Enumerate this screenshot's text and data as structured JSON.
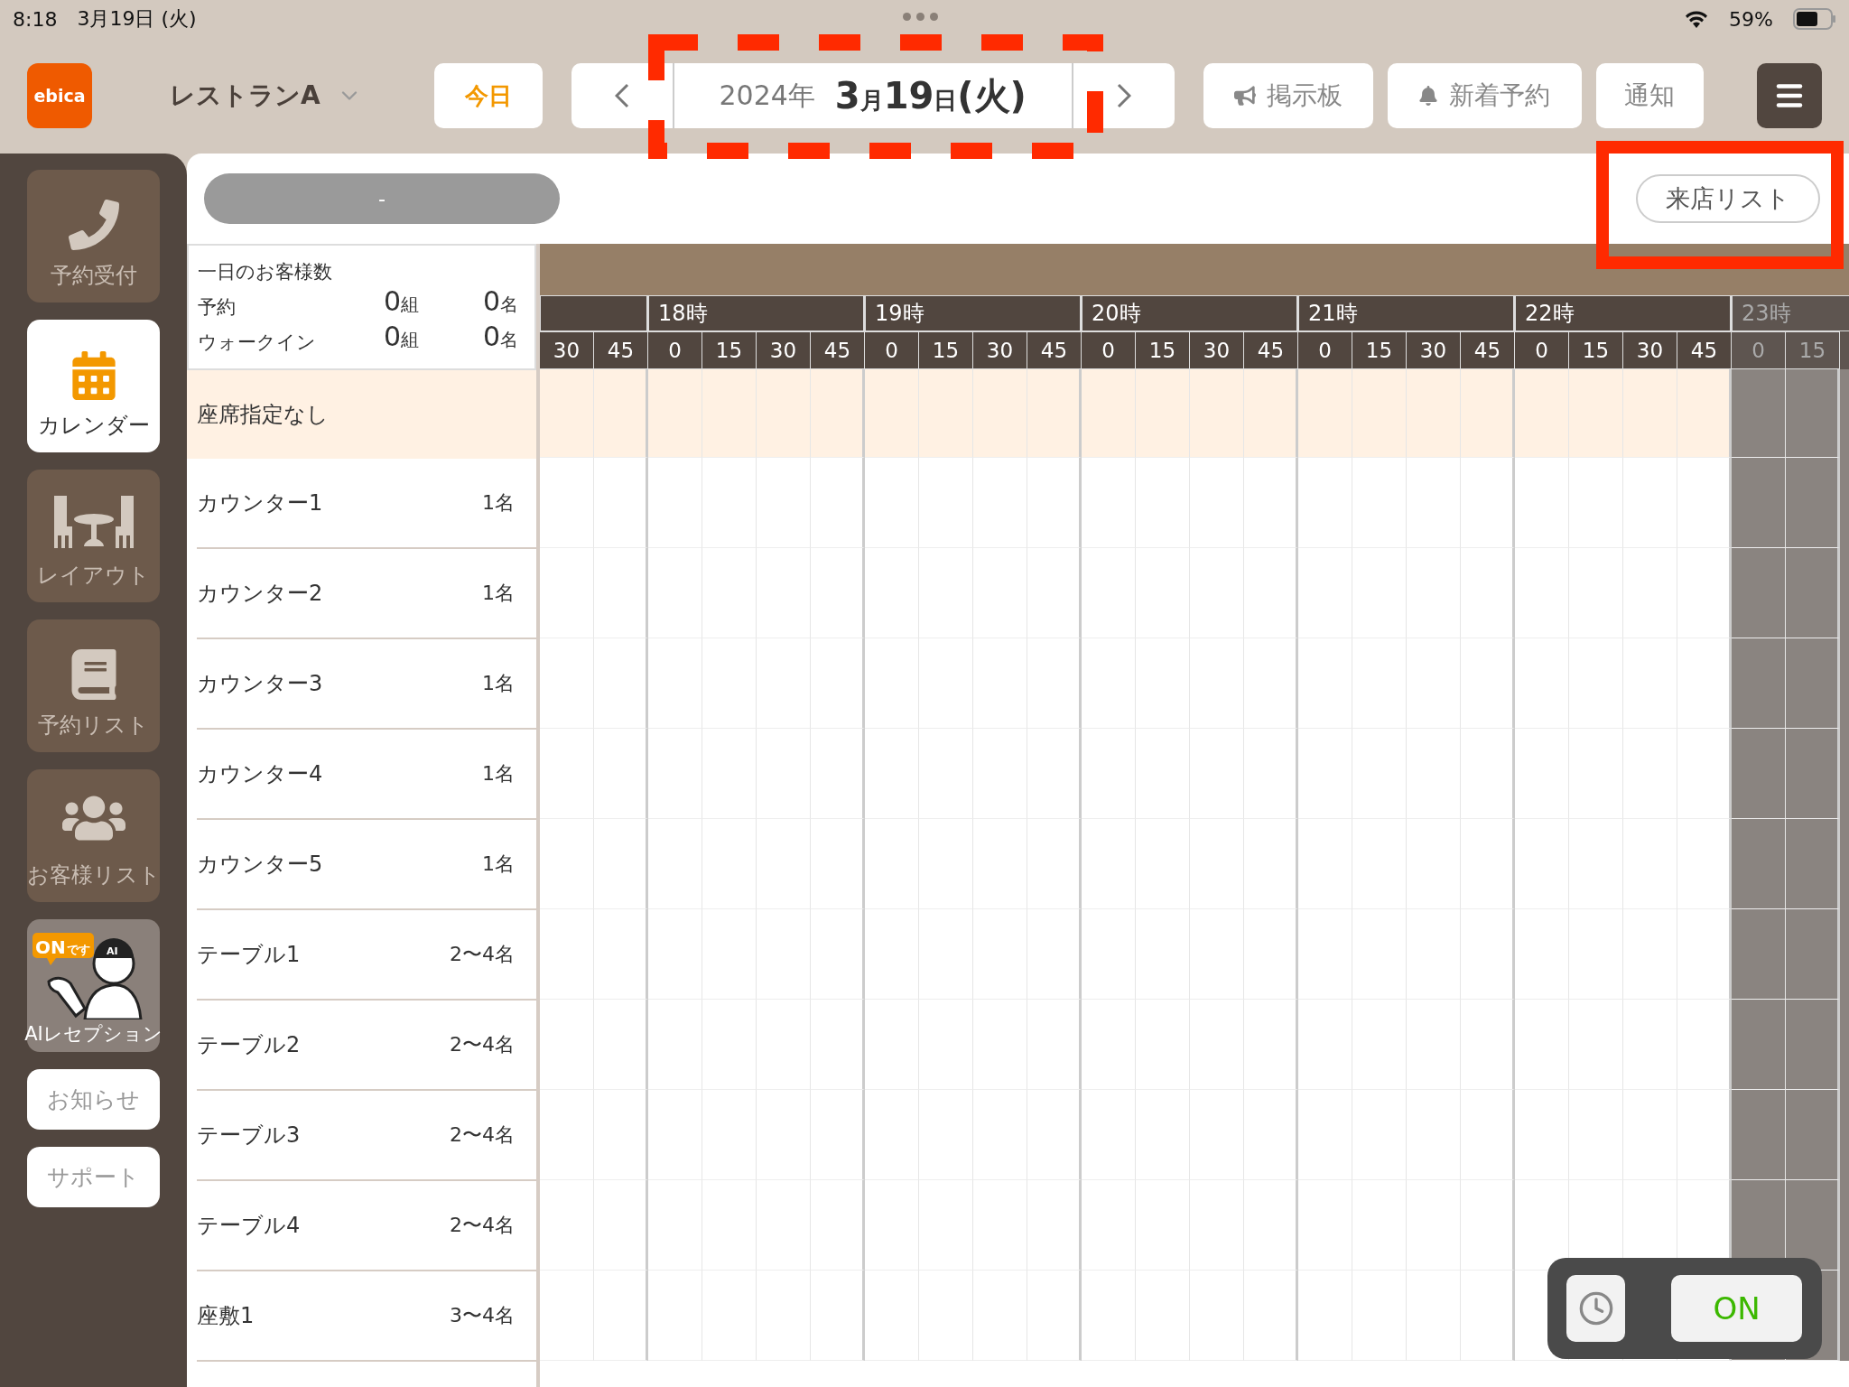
{
  "status_bar": {
    "time": "8:18",
    "date": "3月19日 (火)",
    "battery": "59%"
  },
  "header": {
    "logo": "ebica",
    "store": "レストランA",
    "today": "今日",
    "date": {
      "year": "2024年",
      "month": "3",
      "month_unit": "月",
      "day": "19",
      "day_unit": "日",
      "weekday": "(火)"
    },
    "buttons": [
      {
        "label": "掲示板",
        "kind": "megaphone"
      },
      {
        "label": "新着予約",
        "kind": "bell"
      },
      {
        "label": "通知",
        "kind": "plain"
      }
    ]
  },
  "sidebar": {
    "items": [
      {
        "label": "予約受付",
        "kind": "phone",
        "selected": false
      },
      {
        "label": "カレンダー",
        "kind": "calendar",
        "selected": true
      },
      {
        "label": "レイアウト",
        "kind": "layout",
        "selected": false
      },
      {
        "label": "予約リスト",
        "kind": "book",
        "selected": false
      },
      {
        "label": "お客様リスト",
        "kind": "users",
        "selected": false
      },
      {
        "label": "AIレセプション",
        "kind": "ai",
        "selected": false,
        "badge": "ON",
        "badge_suffix": "です",
        "cap_text": "AI"
      },
      {
        "label": "お知らせ",
        "kind": "plain",
        "selected": false
      },
      {
        "label": "サポート",
        "kind": "plain",
        "selected": false
      }
    ]
  },
  "toolbar": {
    "filter": "-",
    "visit_list": "来店リスト"
  },
  "summary": {
    "title": "一日のお客様数",
    "rows": [
      {
        "label": "予約",
        "groups": "0",
        "groups_unit": "組",
        "people": "0",
        "people_unit": "名"
      },
      {
        "label": "ウォークイン",
        "groups": "0",
        "groups_unit": "組",
        "people": "0",
        "people_unit": "名"
      }
    ]
  },
  "timeline": {
    "hours": [
      {
        "minutes": [
          "30",
          "45"
        ],
        "closed": false
      },
      {
        "label": "18時",
        "minutes": [
          "0",
          "15",
          "30",
          "45"
        ],
        "closed": false
      },
      {
        "label": "19時",
        "minutes": [
          "0",
          "15",
          "30",
          "45"
        ],
        "closed": false
      },
      {
        "label": "20時",
        "minutes": [
          "0",
          "15",
          "30",
          "45"
        ],
        "closed": false
      },
      {
        "label": "21時",
        "minutes": [
          "0",
          "15",
          "30",
          "45"
        ],
        "closed": false
      },
      {
        "label": "22時",
        "minutes": [
          "0",
          "15",
          "30",
          "45"
        ],
        "closed": false
      },
      {
        "label": "23時",
        "minutes": [
          "0",
          "15"
        ],
        "closed": true
      }
    ]
  },
  "seats": [
    {
      "name": "座席指定なし",
      "kind": "unassigned"
    },
    {
      "name": "カウンター1",
      "capacity": "1名",
      "kind": "seat"
    },
    {
      "name": "カウンター2",
      "capacity": "1名",
      "kind": "seat"
    },
    {
      "name": "カウンター3",
      "capacity": "1名",
      "kind": "seat"
    },
    {
      "name": "カウンター4",
      "capacity": "1名",
      "kind": "seat"
    },
    {
      "name": "カウンター5",
      "capacity": "1名",
      "kind": "seat"
    },
    {
      "name": "テーブル1",
      "capacity": "2〜4名",
      "kind": "seat"
    },
    {
      "name": "テーブル2",
      "capacity": "2〜4名",
      "kind": "seat"
    },
    {
      "name": "テーブル3",
      "capacity": "2〜4名",
      "kind": "seat"
    },
    {
      "name": "テーブル4",
      "capacity": "2〜4名",
      "kind": "seat"
    },
    {
      "name": "座敷1",
      "capacity": "3〜4名",
      "kind": "seat"
    }
  ],
  "floating": {
    "toggle": "ON",
    "on": true
  },
  "annotations": [
    {
      "kind": "dashed-frame"
    },
    {
      "kind": "solid-frame"
    }
  ]
}
